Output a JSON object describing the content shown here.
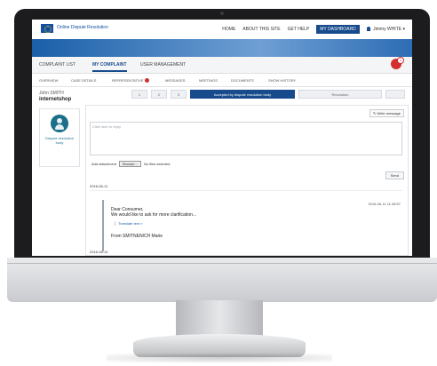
{
  "header": {
    "logo_text": "Online Dispute Resolution",
    "nav": [
      "HOME",
      "ABOUT THIS SITE",
      "GET HELP",
      "MY DASHBOARD"
    ],
    "user": "Jimmy WHITE",
    "user_caret": "▾"
  },
  "tabs": [
    "COMPLAINT LIST",
    "MY COMPLAINT",
    "USER MANAGEMENT"
  ],
  "notification_count": "1",
  "subtabs": [
    "OVERVIEW",
    "CASE DETAILS",
    "REPRESENTATIVE",
    "MESSAGES",
    "MEETINGS",
    "DOCUMENTS",
    "SHOW HISTORY"
  ],
  "case": {
    "person": "John SMITH",
    "shop": "internetshop"
  },
  "stepper": {
    "steps": [
      "1",
      "2",
      "3",
      "Accepted by dispute resolution body",
      "Resolution",
      ""
    ],
    "active_index": 3
  },
  "left_card": {
    "role": "Dispute resolution body"
  },
  "composer": {
    "write_button": "Write message",
    "placeholder": "Click here to reply",
    "attach_label": "Add attachment",
    "browse_label": "Browse...",
    "no_file": "No files selected",
    "send_label": "Send"
  },
  "messages": [
    {
      "date": "2016-06-11",
      "time": "2016-06-11 11:08:57",
      "greeting": "Dear Consumer,",
      "body": "We would like to ask for more clarification...",
      "translate": "Translate text »",
      "from": "From SMITNENICH Marie"
    }
  ],
  "next_date": "2016-06-10"
}
